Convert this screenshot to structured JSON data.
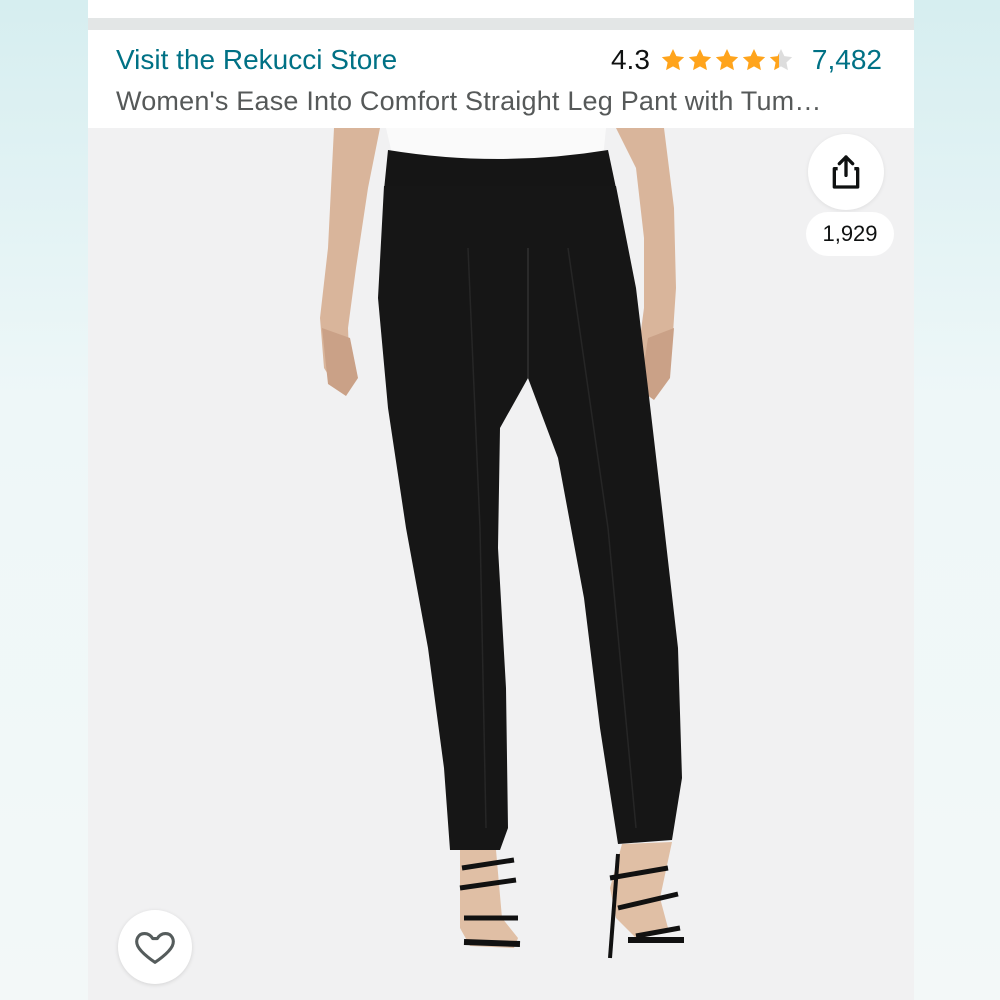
{
  "store": {
    "link_label": "Visit the Rekucci Store"
  },
  "rating": {
    "value": "4.3",
    "stars": 4.3,
    "review_count": "7,482"
  },
  "product": {
    "title": "Women's Ease Into Comfort Straight Leg Pant with Tum…"
  },
  "share": {
    "count": "1,929"
  },
  "icons": {
    "share": "share-icon",
    "wishlist": "heart-icon",
    "star": "star-icon"
  },
  "colors": {
    "link": "#007185",
    "star": "#ffa41c",
    "text": "#0f1111",
    "title": "#565959"
  }
}
